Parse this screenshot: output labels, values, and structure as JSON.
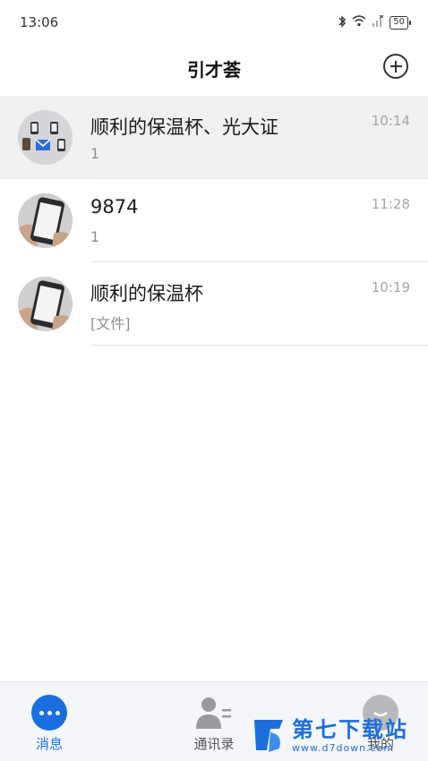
{
  "status_bar": {
    "time": "13:06",
    "battery": "50"
  },
  "header": {
    "title": "引才荟"
  },
  "conversations": [
    {
      "name": "顺利的保温杯、光大证",
      "preview": "1",
      "time": "10:14",
      "avatar": "group-avatar"
    },
    {
      "name": "9874",
      "preview": "1",
      "time": "11:28",
      "avatar": "phone-photo"
    },
    {
      "name": "顺利的保温杯",
      "preview": "[文件]",
      "time": "10:19",
      "avatar": "phone-photo"
    }
  ],
  "bottom_nav": {
    "items": [
      {
        "label": "消息",
        "icon": "chat-bubble-icon",
        "active": true
      },
      {
        "label": "通讯录",
        "icon": "contacts-icon",
        "active": false
      },
      {
        "label": "我的",
        "icon": "profile-icon",
        "active": false
      }
    ]
  },
  "watermark": {
    "title": "第七下载站",
    "url": "www.d7down.com"
  },
  "colors": {
    "accent": "#1a6fe0",
    "active_row": "#f1f1f1",
    "nav_bg": "#f5f6fa"
  }
}
